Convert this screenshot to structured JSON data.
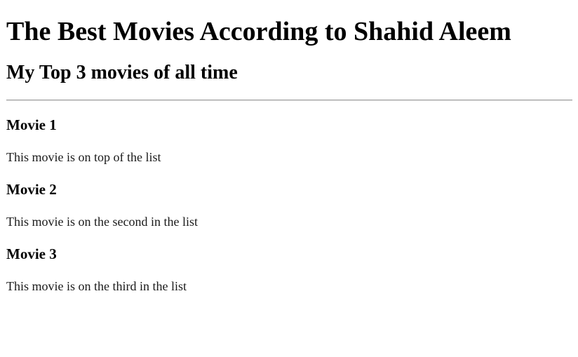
{
  "page": {
    "title": "The Best Movies According to Shahid Aleem",
    "subtitle": "My Top 3 movies of all time"
  },
  "movies": [
    {
      "name": "Movie 1",
      "description": "This movie is on top of the list"
    },
    {
      "name": "Movie 2",
      "description": "This movie is on the second in the list"
    },
    {
      "name": "Movie 3",
      "description": "This movie is on the third in the list"
    }
  ]
}
